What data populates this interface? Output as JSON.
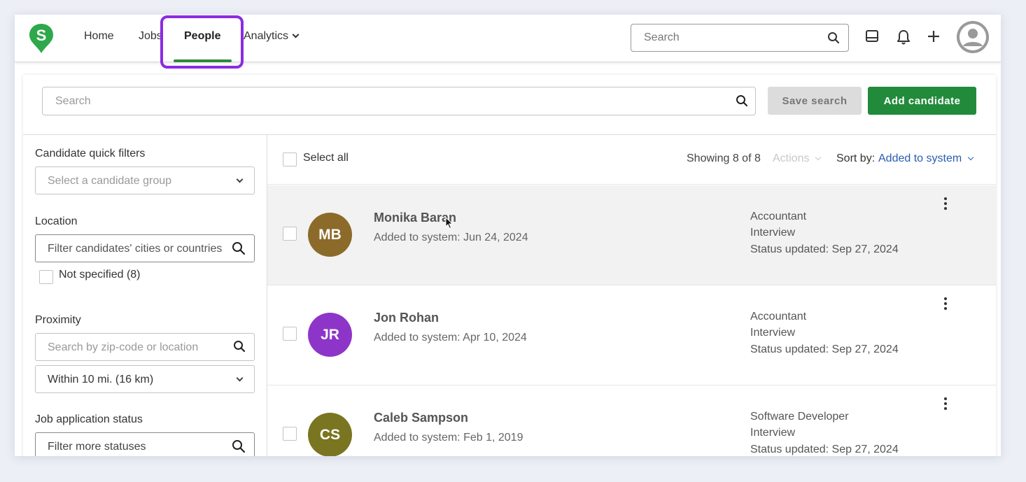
{
  "nav": {
    "logo_letter": "S",
    "items": [
      {
        "label": "Home"
      },
      {
        "label": "Jobs"
      },
      {
        "label": "People"
      },
      {
        "label": "Analytics"
      }
    ],
    "active": "People",
    "search_placeholder": "Search"
  },
  "toolbar": {
    "search_placeholder": "Search",
    "save_search_label": "Save search",
    "add_candidate_label": "Add candidate"
  },
  "filters": {
    "quick_filters": {
      "label": "Candidate quick filters",
      "placeholder": "Select a candidate group"
    },
    "location": {
      "label": "Location",
      "placeholder": "Filter candidates' cities or countries",
      "not_specified": "Not specified (8)"
    },
    "proximity": {
      "label": "Proximity",
      "placeholder": "Search by zip-code or location",
      "radius": "Within 10 mi. (16 km)"
    },
    "job_status": {
      "label": "Job application status",
      "placeholder": "Filter more statuses"
    }
  },
  "list": {
    "select_all": "Select all",
    "showing": "Showing 8 of 8",
    "actions": "Actions",
    "sort_label": "Sort by:",
    "sort_value": "Added to system",
    "candidates": [
      {
        "initials": "MB",
        "name": "Monika Baran",
        "added": "Added to system: Jun 24, 2024",
        "job": "Accountant",
        "stage": "Interview",
        "status": "Status updated: Sep 27, 2024",
        "color": "#8b6a2a"
      },
      {
        "initials": "JR",
        "name": "Jon Rohan",
        "added": "Added to system: Apr 10, 2024",
        "job": "Accountant",
        "stage": "Interview",
        "status": "Status updated: Sep 27, 2024",
        "color": "#8e35c9"
      },
      {
        "initials": "CS",
        "name": "Caleb Sampson",
        "added": "Added to system: Feb 1, 2019",
        "job": "Software Developer",
        "stage": "Interview",
        "status": "Status updated: Sep 27, 2024",
        "color": "#7a7520"
      }
    ]
  },
  "colors": {
    "brand_green": "#228b3b",
    "highlight_purple": "#8b2be2",
    "link_blue": "#2a5db0"
  },
  "icons": [
    "search-icon",
    "inbox-icon",
    "bell-icon",
    "plus-icon",
    "user-avatar-icon",
    "chevron-down-icon",
    "kebab-menu-icon"
  ]
}
